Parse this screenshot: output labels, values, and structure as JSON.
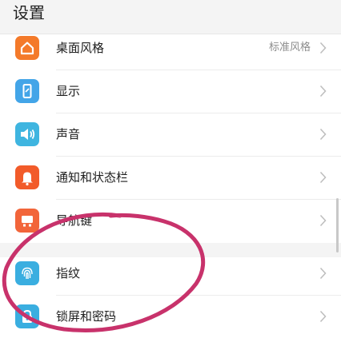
{
  "header": {
    "title": "设置"
  },
  "colors": {
    "accent_circle": "#c8326b"
  },
  "rows": [
    {
      "id": "theme",
      "label": "桌面风格",
      "value": "标准风格",
      "icon": "home-icon",
      "color": "#f47a2a"
    },
    {
      "id": "display",
      "label": "显示",
      "value": "",
      "icon": "phone-display-icon",
      "color": "#43a5e8"
    },
    {
      "id": "sound",
      "label": "声音",
      "value": "",
      "icon": "speaker-icon",
      "color": "#3fb5e0"
    },
    {
      "id": "notifications",
      "label": "通知和状态栏",
      "value": "",
      "icon": "bell-icon",
      "color": "#f25b2a"
    },
    {
      "id": "navigation",
      "label": "导航键",
      "value": "",
      "icon": "navigation-key-icon",
      "color": "#f2653a"
    },
    {
      "id": "fingerprint",
      "label": "指纹",
      "value": "",
      "icon": "fingerprint-icon",
      "color": "#3aaee0"
    },
    {
      "id": "lockscreen",
      "label": "锁屏和密码",
      "value": "",
      "icon": "lock-icon",
      "color": "#3aaee0"
    }
  ]
}
